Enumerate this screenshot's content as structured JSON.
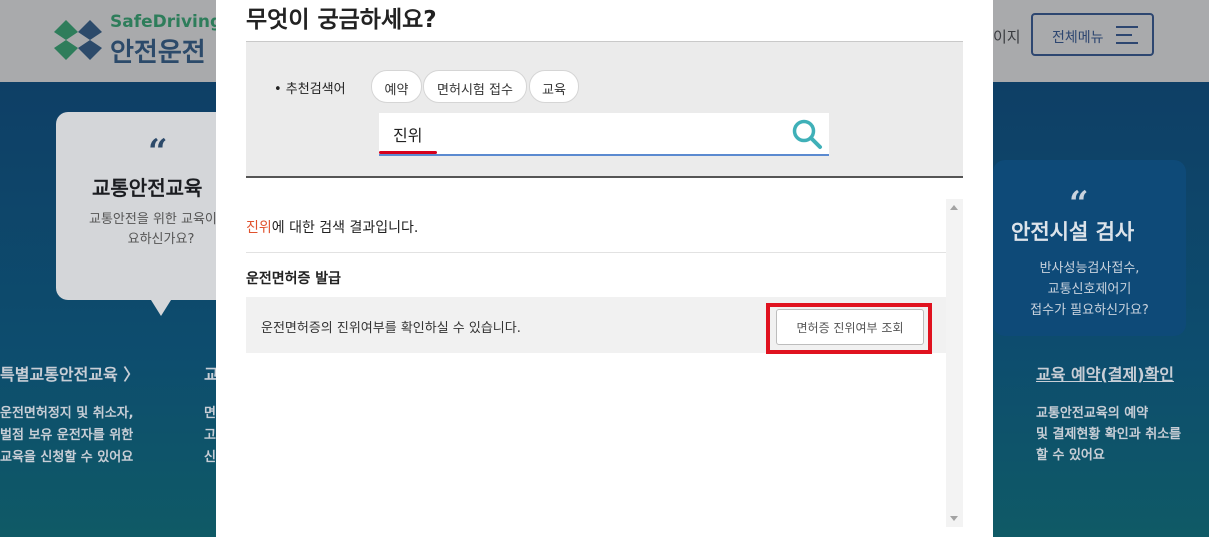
{
  "background": {
    "logo": {
      "en": "SafeDriving",
      "ko": "안전운전"
    },
    "header": {
      "partial_link": "이지",
      "menu_label": "전체메뉴"
    },
    "card_left": {
      "quote": "“",
      "title": "교통안전교육",
      "desc": "교통안전을 위한 교육이 필요하신가요?"
    },
    "card_right": {
      "quote": "“",
      "title": "안전시설 검사",
      "desc_lines": [
        "반사성능검사접수,",
        "교통신호제어기",
        "접수가 필요하신가요?"
      ]
    },
    "left_link": "특별교통안전교육 〉",
    "left_desc_lines": [
      "운전면허정지 및 취소자,",
      "벌점 보유 운전자를 위한",
      "교육을 신청할 수 있어요"
    ],
    "left_mark": "교",
    "left_mark_lines": [
      "면",
      "고",
      "신"
    ],
    "right_link": "교육 예약(결제)확인",
    "right_desc_lines": [
      "교통안전교육의 예약",
      "및 결제현황 확인과 취소를",
      "할 수 있어요"
    ]
  },
  "modal": {
    "title": "무엇이 궁금하세요?",
    "recommend_label": "• 추천검색어",
    "chips": [
      "예약",
      "면허시험 접수",
      "교육"
    ],
    "search_value": "진위",
    "result_note": {
      "keyword": "진위",
      "suffix": "에 대한 검색 결과입니다."
    },
    "section_title": "운전면허증 발급",
    "result_text": "운전면허증의 진위여부를 확인하실 수 있습니다.",
    "verify_button": "면허증 진위여부 조회"
  },
  "colors": {
    "accent_red": "#e0121f",
    "keyword_orange": "#e0522e",
    "search_icon": "#3fb0b8",
    "search_underline": "#5b8ad0"
  },
  "icons": {
    "search": "search-icon",
    "menu": "hamburger-icon",
    "logo": "clover-logo-icon"
  }
}
